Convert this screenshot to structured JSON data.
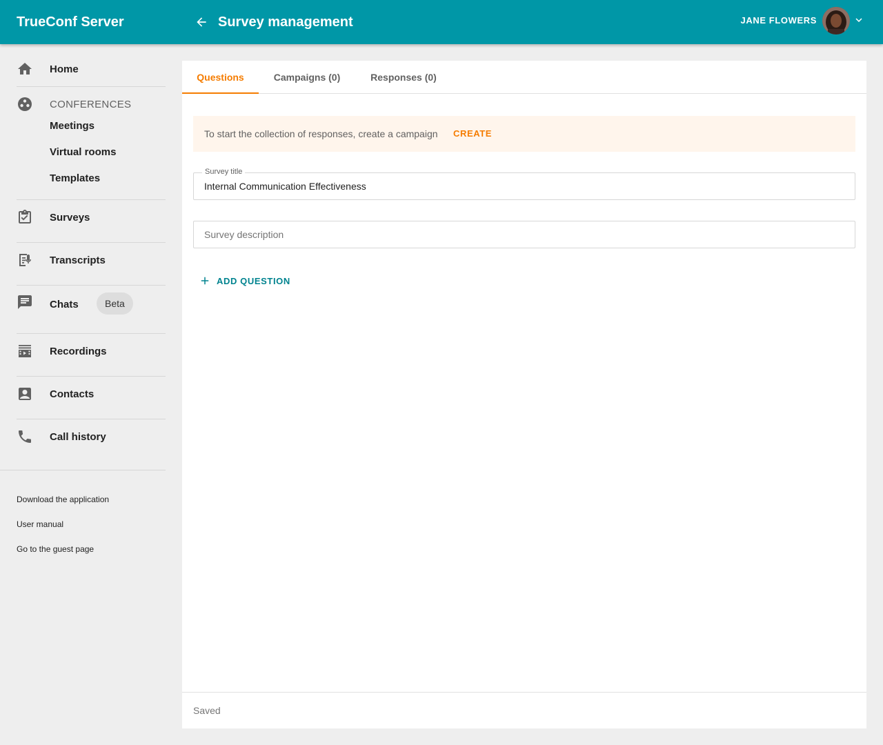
{
  "header": {
    "brand": "TrueConf Server",
    "title": "Survey management",
    "user_name": "JANE FLOWERS"
  },
  "sidebar": {
    "home": "Home",
    "conferences_section": "CONFERENCES",
    "meetings": "Meetings",
    "virtual_rooms": "Virtual rooms",
    "templates": "Templates",
    "surveys": "Surveys",
    "transcripts": "Transcripts",
    "chats": "Chats",
    "chats_badge": "Beta",
    "recordings": "Recordings",
    "contacts": "Contacts",
    "call_history": "Call history",
    "footer_links": [
      "Download the application",
      "User manual",
      "Go to the guest page"
    ]
  },
  "tabs": [
    {
      "label": "Questions",
      "active": true
    },
    {
      "label": "Campaigns (0)",
      "active": false
    },
    {
      "label": "Responses (0)",
      "active": false
    }
  ],
  "banner": {
    "text": "To start the collection of responses, create a campaign",
    "action": "CREATE"
  },
  "form": {
    "title_label": "Survey title",
    "title_value": "Internal Communication Effectiveness",
    "description_placeholder": "Survey description",
    "description_value": ""
  },
  "add_question_label": "ADD QUESTION",
  "status": "Saved",
  "colors": {
    "primary": "#0097a7",
    "accent": "#f57c00",
    "banner_bg": "#fff5ec",
    "link": "#00838f"
  }
}
